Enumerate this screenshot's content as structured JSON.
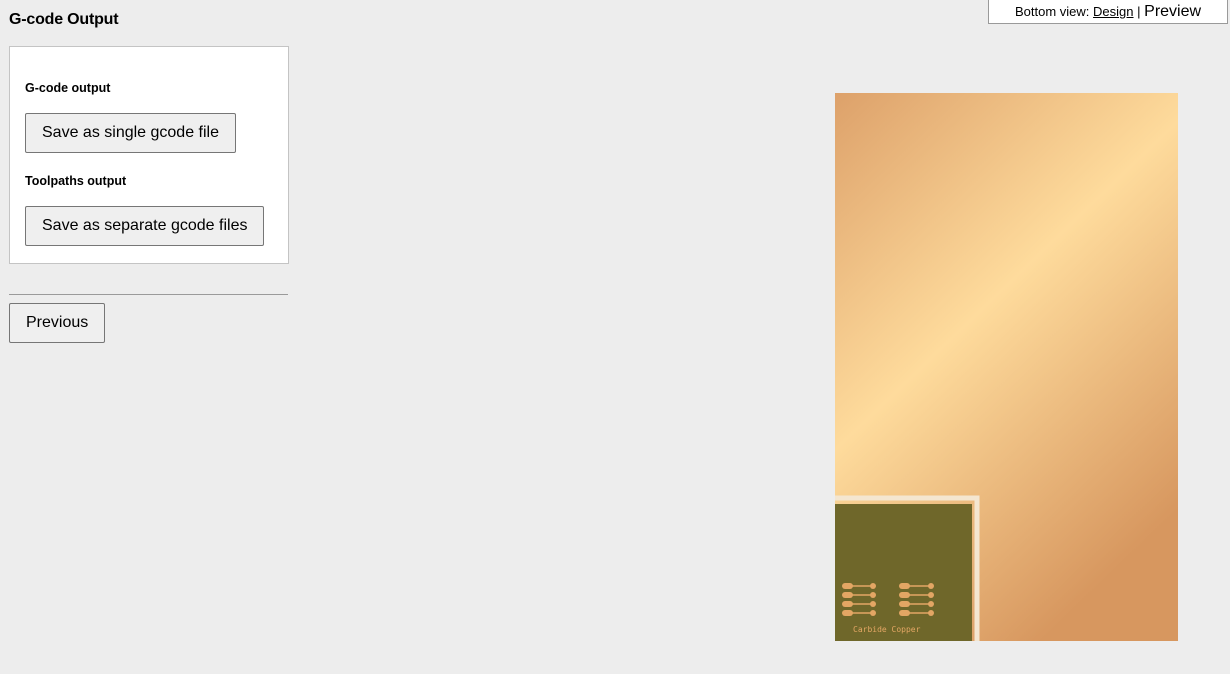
{
  "page": {
    "title": "G-code Output"
  },
  "output_panel": {
    "gcode_section_label": "G-code output",
    "save_single_label": "Save as single gcode file",
    "toolpaths_section_label": "Toolpaths output",
    "save_separate_label": "Save as separate gcode files"
  },
  "navigation": {
    "previous_label": "Previous"
  },
  "view_switch": {
    "prefix": "Bottom view:",
    "design_label": "Design",
    "separator": "|",
    "preview_label": "Preview"
  },
  "preview": {
    "board_text": "Carbide Copper",
    "colors": {
      "stock_copper_light": "#fedb9c",
      "stock_copper_dark": "#d7975f",
      "board_fill": "#6f672a",
      "trace_color": "#e3a664"
    }
  }
}
